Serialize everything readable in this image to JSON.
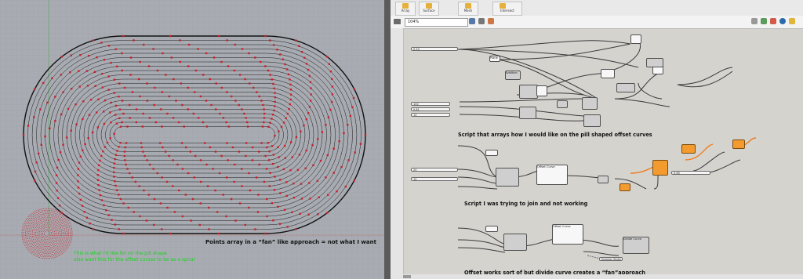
{
  "viewport": {
    "caption": "Points array in a “fan” like approach = not what I want",
    "green_line1": "This is what I'd like for on the pill shape",
    "green_line2": "also want this for the offset curves to be as a spiral"
  },
  "grasshopper": {
    "component_tabs": [
      "Array",
      "Surface",
      "Mesh",
      "Intersect"
    ],
    "zoom": "104%",
    "captions": {
      "script1": "Script that arrays how I would like on the pill shaped offset curves",
      "script2": "Script I was trying to join and not working",
      "script3": "Offset works sort of but divide curve creates a “fan”approach"
    },
    "components": {
      "radius": "Radius",
      "plane": "Plane",
      "addition": "Addition",
      "circle": "Circle",
      "series": "Series",
      "divide_curve": "Divide Curve",
      "rotate": "Rotate",
      "length": "Length",
      "offset_curve": "Offset Curve",
      "area": "Area",
      "polar_array": "Polar Array",
      "number": "Number Slider"
    },
    "sliders": [
      {
        "label": "0.20"
      },
      {
        "label": "100"
      },
      {
        "label": "0.81"
      },
      {
        "label": "12"
      },
      {
        "label": "0.60"
      },
      {
        "label": "20"
      },
      {
        "label": "10"
      }
    ]
  },
  "colors": {
    "viewport_bg": "#a8acb2",
    "gh_canvas": "#d4d3ce",
    "points": "#c8202a",
    "accent_orange": "#f39b2e",
    "green_text": "#15d61b"
  }
}
